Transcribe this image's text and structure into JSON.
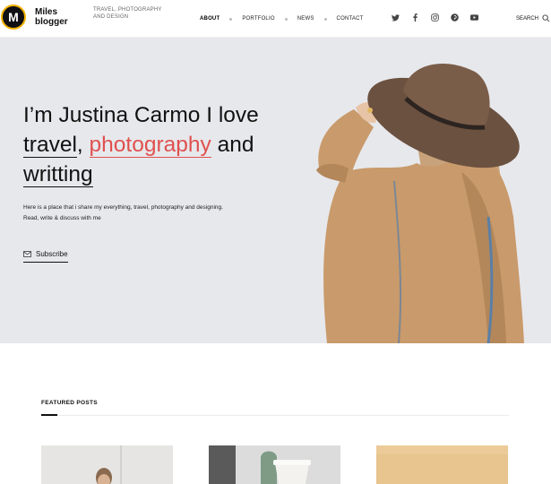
{
  "brand": {
    "logo_letter": "M",
    "name_line1": "Miles",
    "name_line2": "blogger",
    "tagline": "TRAVEL, PHOTOGRAPHY AND DESIGN"
  },
  "nav": {
    "items": [
      {
        "label": "ABOUT",
        "active": true
      },
      {
        "label": "PORTFOLIO",
        "active": false
      },
      {
        "label": "NEWS",
        "active": false
      },
      {
        "label": "CONTACT",
        "active": false
      }
    ]
  },
  "social": [
    "twitter-icon",
    "facebook-icon",
    "instagram-icon",
    "pinterest-icon",
    "youtube-icon"
  ],
  "search": {
    "label": "SEARCH"
  },
  "hero": {
    "title_prefix": "I’m Justina Carmo I love ",
    "word1": "travel",
    "comma": ", ",
    "word2": "photography",
    "and": " and",
    "word3": "writting",
    "description": "Here is a place that i share my everything, travel, photography and designing. Read, write & discuss with me",
    "subscribe_label": "Subscribe"
  },
  "featured": {
    "title": "FEATURED POSTS"
  },
  "colors": {
    "accent_red": "#e0504f",
    "logo_ring": "#f2b200",
    "hero_bg": "#e7e8ec"
  }
}
